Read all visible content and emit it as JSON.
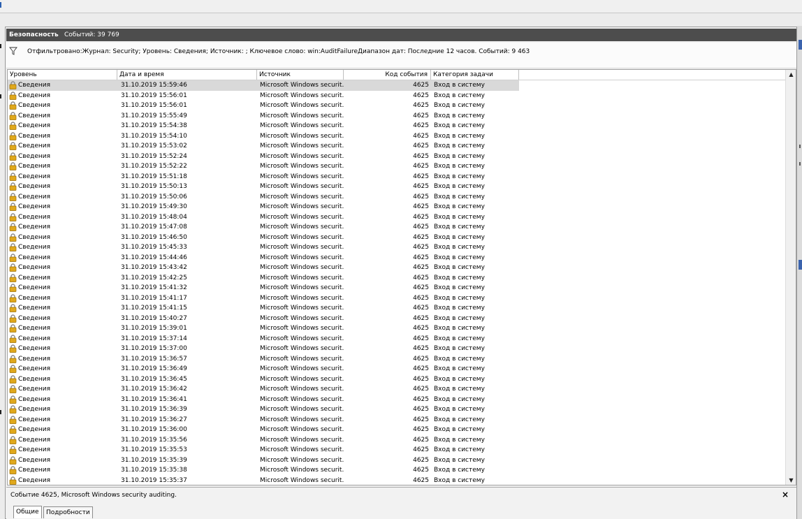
{
  "panel": {
    "title": "Безопасность",
    "event_count": "Событий: 39 769"
  },
  "filter": {
    "icon": "funnel-icon",
    "text": "Отфильтровано:Журнал: Security; Уровень: Сведения; Источник: ; Ключевое слово: win:AuditFailureДиапазон дат: Последние 12 часов. Событий: 9 463"
  },
  "columns": {
    "level": "Уровень",
    "date": "Дата и время",
    "source": "Источник",
    "code": "Код события",
    "category": "Категория задачи"
  },
  "level_icon": "lock-icon",
  "colors": {
    "lock": "#e0a81c",
    "titlebar": "#4d4d4d",
    "selected_row": "#d9d9d9"
  },
  "rows": [
    {
      "level": "Сведения",
      "date": "31.10.2019 15:59:46",
      "source": "Microsoft Windows securit...",
      "code": "4625",
      "category": "Вход в систему"
    },
    {
      "level": "Сведения",
      "date": "31.10.2019 15:56:01",
      "source": "Microsoft Windows securit...",
      "code": "4625",
      "category": "Вход в систему"
    },
    {
      "level": "Сведения",
      "date": "31.10.2019 15:56:01",
      "source": "Microsoft Windows securit...",
      "code": "4625",
      "category": "Вход в систему"
    },
    {
      "level": "Сведения",
      "date": "31.10.2019 15:55:49",
      "source": "Microsoft Windows securit...",
      "code": "4625",
      "category": "Вход в систему"
    },
    {
      "level": "Сведения",
      "date": "31.10.2019 15:54:38",
      "source": "Microsoft Windows securit...",
      "code": "4625",
      "category": "Вход в систему"
    },
    {
      "level": "Сведения",
      "date": "31.10.2019 15:54:10",
      "source": "Microsoft Windows securit...",
      "code": "4625",
      "category": "Вход в систему"
    },
    {
      "level": "Сведения",
      "date": "31.10.2019 15:53:02",
      "source": "Microsoft Windows securit...",
      "code": "4625",
      "category": "Вход в систему"
    },
    {
      "level": "Сведения",
      "date": "31.10.2019 15:52:24",
      "source": "Microsoft Windows securit...",
      "code": "4625",
      "category": "Вход в систему"
    },
    {
      "level": "Сведения",
      "date": "31.10.2019 15:52:22",
      "source": "Microsoft Windows securit...",
      "code": "4625",
      "category": "Вход в систему"
    },
    {
      "level": "Сведения",
      "date": "31.10.2019 15:51:18",
      "source": "Microsoft Windows securit...",
      "code": "4625",
      "category": "Вход в систему"
    },
    {
      "level": "Сведения",
      "date": "31.10.2019 15:50:13",
      "source": "Microsoft Windows securit...",
      "code": "4625",
      "category": "Вход в систему"
    },
    {
      "level": "Сведения",
      "date": "31.10.2019 15:50:06",
      "source": "Microsoft Windows securit...",
      "code": "4625",
      "category": "Вход в систему"
    },
    {
      "level": "Сведения",
      "date": "31.10.2019 15:49:30",
      "source": "Microsoft Windows securit...",
      "code": "4625",
      "category": "Вход в систему"
    },
    {
      "level": "Сведения",
      "date": "31.10.2019 15:48:04",
      "source": "Microsoft Windows securit...",
      "code": "4625",
      "category": "Вход в систему"
    },
    {
      "level": "Сведения",
      "date": "31.10.2019 15:47:08",
      "source": "Microsoft Windows securit...",
      "code": "4625",
      "category": "Вход в систему"
    },
    {
      "level": "Сведения",
      "date": "31.10.2019 15:46:50",
      "source": "Microsoft Windows securit...",
      "code": "4625",
      "category": "Вход в систему"
    },
    {
      "level": "Сведения",
      "date": "31.10.2019 15:45:33",
      "source": "Microsoft Windows securit...",
      "code": "4625",
      "category": "Вход в систему"
    },
    {
      "level": "Сведения",
      "date": "31.10.2019 15:44:46",
      "source": "Microsoft Windows securit...",
      "code": "4625",
      "category": "Вход в систему"
    },
    {
      "level": "Сведения",
      "date": "31.10.2019 15:43:42",
      "source": "Microsoft Windows securit...",
      "code": "4625",
      "category": "Вход в систему"
    },
    {
      "level": "Сведения",
      "date": "31.10.2019 15:42:25",
      "source": "Microsoft Windows securit...",
      "code": "4625",
      "category": "Вход в систему"
    },
    {
      "level": "Сведения",
      "date": "31.10.2019 15:41:32",
      "source": "Microsoft Windows securit...",
      "code": "4625",
      "category": "Вход в систему"
    },
    {
      "level": "Сведения",
      "date": "31.10.2019 15:41:17",
      "source": "Microsoft Windows securit...",
      "code": "4625",
      "category": "Вход в систему"
    },
    {
      "level": "Сведения",
      "date": "31.10.2019 15:41:15",
      "source": "Microsoft Windows securit...",
      "code": "4625",
      "category": "Вход в систему"
    },
    {
      "level": "Сведения",
      "date": "31.10.2019 15:40:27",
      "source": "Microsoft Windows securit...",
      "code": "4625",
      "category": "Вход в систему"
    },
    {
      "level": "Сведения",
      "date": "31.10.2019 15:39:01",
      "source": "Microsoft Windows securit...",
      "code": "4625",
      "category": "Вход в систему"
    },
    {
      "level": "Сведения",
      "date": "31.10.2019 15:37:14",
      "source": "Microsoft Windows securit...",
      "code": "4625",
      "category": "Вход в систему"
    },
    {
      "level": "Сведения",
      "date": "31.10.2019 15:37:00",
      "source": "Microsoft Windows securit...",
      "code": "4625",
      "category": "Вход в систему"
    },
    {
      "level": "Сведения",
      "date": "31.10.2019 15:36:57",
      "source": "Microsoft Windows securit...",
      "code": "4625",
      "category": "Вход в систему"
    },
    {
      "level": "Сведения",
      "date": "31.10.2019 15:36:49",
      "source": "Microsoft Windows securit...",
      "code": "4625",
      "category": "Вход в систему"
    },
    {
      "level": "Сведения",
      "date": "31.10.2019 15:36:45",
      "source": "Microsoft Windows securit...",
      "code": "4625",
      "category": "Вход в систему"
    },
    {
      "level": "Сведения",
      "date": "31.10.2019 15:36:42",
      "source": "Microsoft Windows securit...",
      "code": "4625",
      "category": "Вход в систему"
    },
    {
      "level": "Сведения",
      "date": "31.10.2019 15:36:41",
      "source": "Microsoft Windows securit...",
      "code": "4625",
      "category": "Вход в систему"
    },
    {
      "level": "Сведения",
      "date": "31.10.2019 15:36:39",
      "source": "Microsoft Windows securit...",
      "code": "4625",
      "category": "Вход в систему"
    },
    {
      "level": "Сведения",
      "date": "31.10.2019 15:36:27",
      "source": "Microsoft Windows securit...",
      "code": "4625",
      "category": "Вход в систему"
    },
    {
      "level": "Сведения",
      "date": "31.10.2019 15:36:00",
      "source": "Microsoft Windows securit...",
      "code": "4625",
      "category": "Вход в систему"
    },
    {
      "level": "Сведения",
      "date": "31.10.2019 15:35:56",
      "source": "Microsoft Windows securit...",
      "code": "4625",
      "category": "Вход в систему"
    },
    {
      "level": "Сведения",
      "date": "31.10.2019 15:35:53",
      "source": "Microsoft Windows securit...",
      "code": "4625",
      "category": "Вход в систему"
    },
    {
      "level": "Сведения",
      "date": "31.10.2019 15:35:39",
      "source": "Microsoft Windows securit...",
      "code": "4625",
      "category": "Вход в систему"
    },
    {
      "level": "Сведения",
      "date": "31.10.2019 15:35:38",
      "source": "Microsoft Windows securit...",
      "code": "4625",
      "category": "Вход в систему"
    },
    {
      "level": "Сведения",
      "date": "31.10.2019 15:35:37",
      "source": "Microsoft Windows securit...",
      "code": "4625",
      "category": "Вход в систему"
    }
  ],
  "details": {
    "event_title": "Событие 4625, Microsoft Windows security auditing.",
    "close_label": "×",
    "tabs": [
      "Общие",
      "Подробности"
    ]
  }
}
